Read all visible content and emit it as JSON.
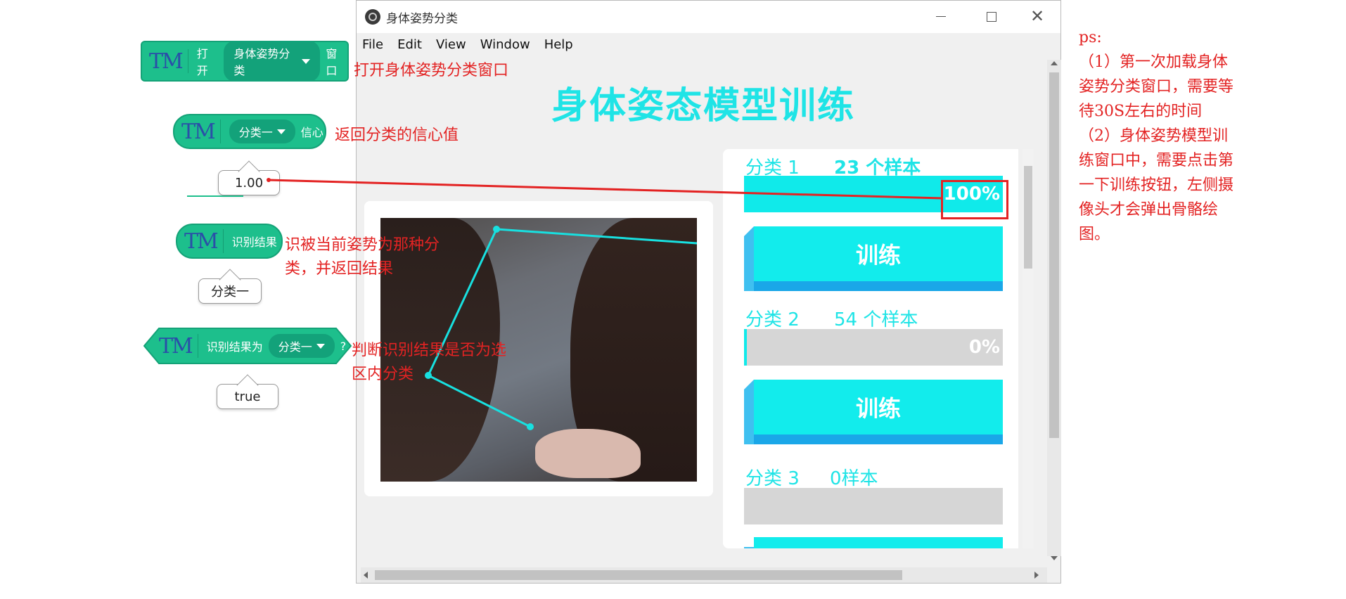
{
  "blocks": {
    "open": {
      "tm": "TM",
      "prefix": "打开",
      "dropdown": "身体姿势分类",
      "suffix": "窗口"
    },
    "confidence": {
      "tm": "TM",
      "dropdown": "分类一",
      "suffix": "信心",
      "result": "1.00"
    },
    "recognize": {
      "tm": "TM",
      "label": "识别结果",
      "result": "分类一"
    },
    "is_result": {
      "tm": "TM",
      "label": "识别结果为",
      "dropdown": "分类一",
      "suffix": "?",
      "result": "true"
    }
  },
  "annotations": {
    "open": "打开身体姿势分类窗口",
    "confidence": "返回分类的信心值",
    "recognize_1": "识被当前姿势为那种分",
    "recognize_2": "类，并返回结果",
    "judge_1": "判断识别结果是否为选",
    "judge_2": "区内分类"
  },
  "window": {
    "title": "身体姿势分类",
    "menu": [
      "File",
      "Edit",
      "View",
      "Window",
      "Help"
    ],
    "heading": "身体姿态模型训练"
  },
  "classes": [
    {
      "name": "分类 1",
      "samples": "23 个样本",
      "progress": 1.0,
      "percent": "100%",
      "button": "训练"
    },
    {
      "name": "分类 2",
      "samples": "54 个样本",
      "progress": 0.01,
      "percent": "0%",
      "button": "训练"
    },
    {
      "name": "分类 3",
      "samples": "0样本",
      "progress": 0.0,
      "percent": "",
      "button": ""
    }
  ],
  "notes": {
    "title": "ps:",
    "lines": [
      "（1）第一次加载身体",
      "姿势分类窗口，需要等",
      "待30S左右的时间",
      "（2）身体姿势模型训",
      "练窗口中，需要点击第",
      "一下训练按钮，左侧摄",
      "像头才会弹出骨骼绘",
      "图。"
    ]
  },
  "colors": {
    "block": "#1dbf8c",
    "accent": "#12ecec",
    "annotation": "#e32323"
  }
}
